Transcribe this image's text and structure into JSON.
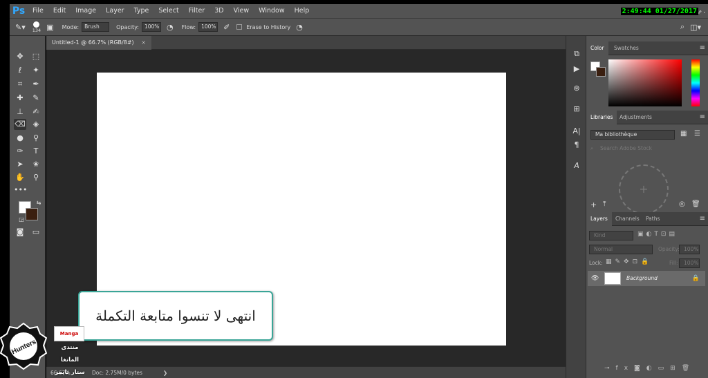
{
  "app": {
    "logo": "Ps"
  },
  "menu": [
    "File",
    "Edit",
    "Image",
    "Layer",
    "Type",
    "Select",
    "Filter",
    "3D",
    "View",
    "Window",
    "Help"
  ],
  "clock": "2:49:44 01/27/2017",
  "clock_extra": "م ,",
  "options": {
    "brush_size": "134",
    "mode_label": "Mode:",
    "mode_value": "Brush",
    "opacity_label": "Opacity:",
    "opacity_value": "100%",
    "flow_label": "Flow:",
    "flow_value": "100%",
    "erase_history": "Erase to History"
  },
  "document": {
    "tab_title": "Untitled-1 @ 66.7% (RGB/8#)",
    "close": "×"
  },
  "status": {
    "zoom": "66.67%",
    "doc_info": "Doc: 2.75M/0 bytes",
    "arrow": "❯"
  },
  "panels": {
    "color_tabs": [
      "Color",
      "Swatches"
    ],
    "library_tabs": [
      "Libraries",
      "Adjustments"
    ],
    "library_select": "Ma bibliothèque",
    "library_search": "Search Adobe Stock",
    "layers_tabs": [
      "Layers",
      "Channels",
      "Paths"
    ],
    "kind": "Kind",
    "blend_mode": "Normal",
    "opacity_label": "Opacity:",
    "opacity_value": "100%",
    "lock_label": "Lock:",
    "fill_label": "Fill:",
    "fill_value": "100%",
    "layer_name": "Background"
  },
  "overlay": {
    "caption": "انتهى لا تنسوا متابعة التكملة",
    "forum_line1": "منتدى المانغا",
    "forum_line2": "ستار تايمز",
    "forum_logo": "Manga",
    "badge_text": "Hunters"
  },
  "colors": {
    "foreground": "#ffffff",
    "background": "#3a1f10",
    "accent": "#31a8ff",
    "clock": "#00ff00"
  }
}
